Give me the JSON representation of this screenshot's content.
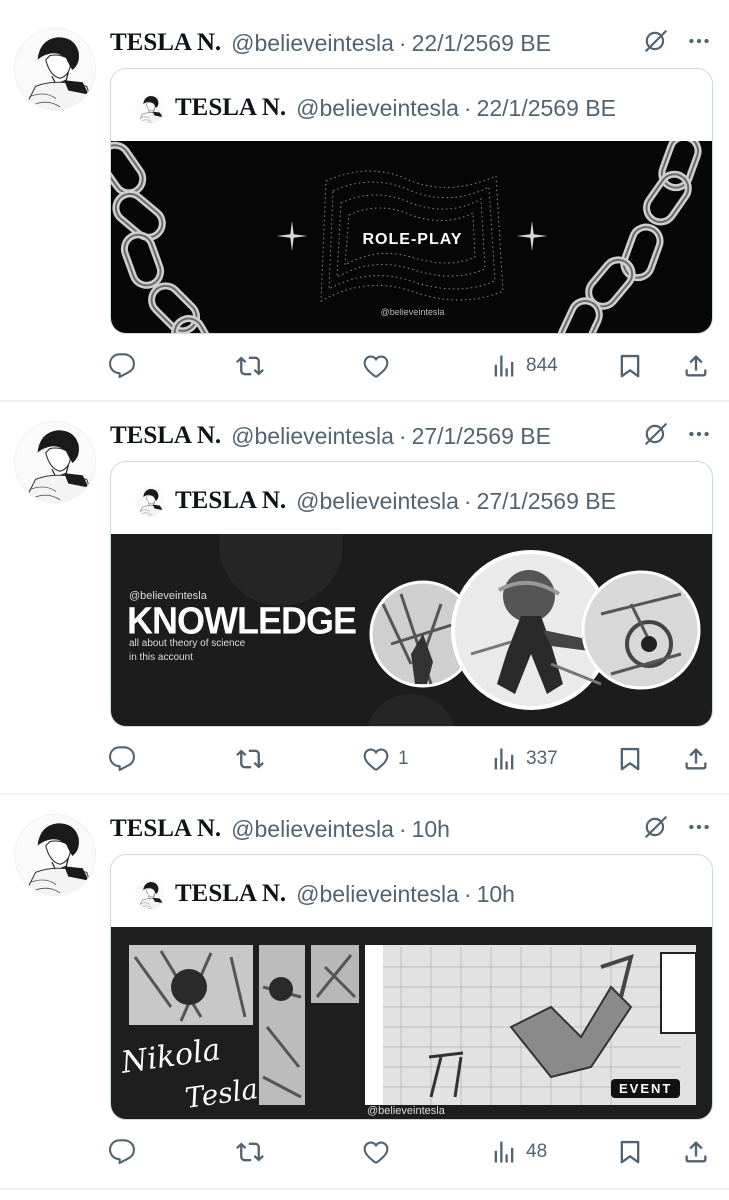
{
  "tweets": [
    {
      "name": "TESLA N.",
      "handle": "@believeintesla",
      "time": "22/1/2569 BE",
      "quote": {
        "name": "TESLA N.",
        "handle": "@believeintesla",
        "time": "22/1/2569 BE"
      },
      "media": {
        "title": "ROLE-PLAY",
        "watermark": "@believeintesla"
      },
      "stats": {
        "replies": "",
        "reposts": "",
        "likes": "",
        "views": "844"
      }
    },
    {
      "name": "TESLA N.",
      "handle": "@believeintesla",
      "time": "27/1/2569 BE",
      "quote": {
        "name": "TESLA N.",
        "handle": "@believeintesla",
        "time": "27/1/2569 BE"
      },
      "media": {
        "handle": "@believeintesla",
        "title": "KNOWLEDGE",
        "subtitle1": "all about theory of science",
        "subtitle2": "in this account"
      },
      "stats": {
        "replies": "",
        "reposts": "",
        "likes": "1",
        "views": "337"
      }
    },
    {
      "name": "TESLA N.",
      "handle": "@believeintesla",
      "time": "10h",
      "quote": {
        "name": "TESLA N.",
        "handle": "@believeintesla",
        "time": "10h"
      },
      "media": {
        "script1": "Nikola",
        "script2": "Tesla",
        "badge": "EVENT",
        "watermark": "@believeintesla"
      },
      "stats": {
        "replies": "",
        "reposts": "",
        "likes": "",
        "views": "48"
      }
    }
  ],
  "icons": {
    "reply": "reply-icon",
    "repost": "repost-icon",
    "like": "heart-icon",
    "views": "views-icon",
    "bookmark": "bookmark-icon",
    "share": "share-icon",
    "grok": "grok-icon",
    "more": "more-icon"
  }
}
